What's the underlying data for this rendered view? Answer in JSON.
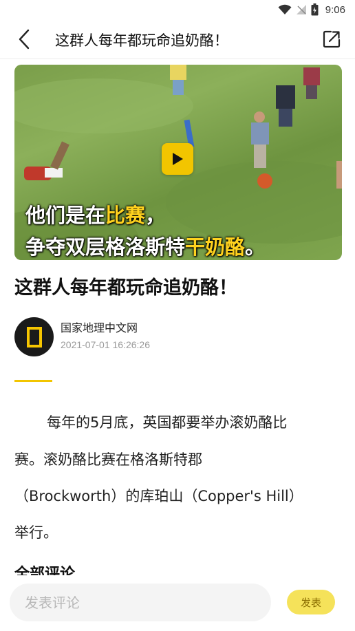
{
  "status_bar": {
    "time": "9:06",
    "icons": [
      "wifi-icon",
      "no-signal-icon",
      "battery-icon"
    ]
  },
  "top_bar": {
    "title": "这群人每年都玩命追奶酪！",
    "back_icon": "back-chevron-icon",
    "share_icon": "share-external-icon"
  },
  "video": {
    "caption_line1_prefix": "他们是在",
    "caption_line1_highlight": "比赛",
    "caption_line1_suffix": "，",
    "caption_line2_prefix": "争夺双层格洛斯特",
    "caption_line2_highlight": "干奶酪",
    "caption_line2_suffix": "。",
    "play_icon": "play-icon"
  },
  "article": {
    "title": "这群人每年都玩命追奶酪！",
    "author": {
      "name": "国家地理中文网",
      "date": "2021-07-01 16:26:26"
    },
    "body_lines": [
      "每年的5月底，英国都要举办滚奶酪比",
      "赛。滚奶酪比赛在格洛斯特郡",
      "（Brockworth）的库珀山（Copper's Hill）",
      "举行。"
    ],
    "comments_heading": "全部评论"
  },
  "bottom_bar": {
    "comment_placeholder": "发表评论",
    "comment_value": "",
    "publish_label": "发表"
  },
  "colors": {
    "accent": "#f2c500",
    "publish_button_bg": "#f5e25a",
    "caption_highlight": "#ffd21e"
  }
}
